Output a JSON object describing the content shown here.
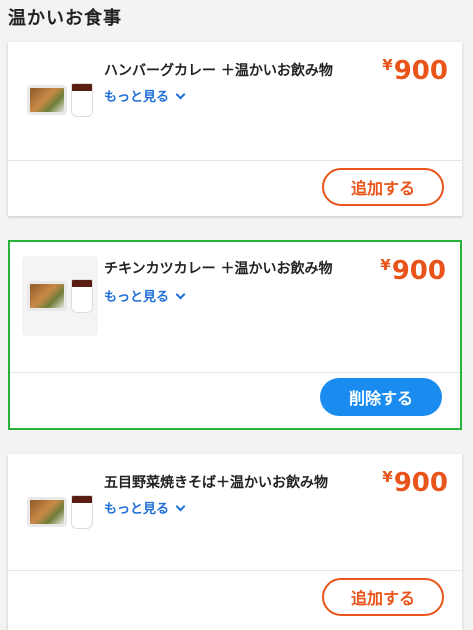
{
  "section": {
    "title": "温かいお食事"
  },
  "items": [
    {
      "name": "ハンバーグカレー ＋温かいお飲み物",
      "more_label": "もっと見る",
      "currency": "¥",
      "price": "900",
      "action_label": "追加する"
    },
    {
      "name": "チキンカツカレー ＋温かいお飲み物",
      "more_label": "もっと見る",
      "currency": "¥",
      "price": "900",
      "action_label": "削除する"
    },
    {
      "name": "五目野菜焼きそば＋温かいお飲み物",
      "more_label": "もっと見る",
      "currency": "¥",
      "price": "900",
      "action_label": "追加する"
    }
  ],
  "colors": {
    "price": "#e8541a",
    "link": "#1e6fd9",
    "selected_border": "#27b33a",
    "remove_button": "#1a8cf0"
  },
  "icons": [
    "chevron-down-icon"
  ]
}
